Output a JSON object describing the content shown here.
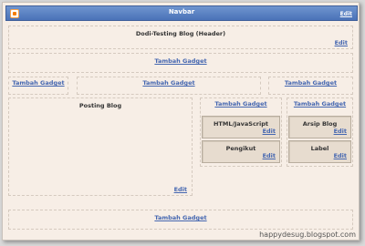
{
  "navbar": {
    "title": "Navbar",
    "edit_label": "Edit"
  },
  "header": {
    "title": "Dodi-Testing Blog (Header)",
    "edit_label": "Edit"
  },
  "gadget_link": "Tambah Gadget",
  "main": {
    "title": "Posting Blog",
    "edit_label": "Edit"
  },
  "widgets": [
    {
      "label": "HTML/JavaScript",
      "edit_label": "Edit"
    },
    {
      "label": "Arsip Blog",
      "edit_label": "Edit"
    },
    {
      "label": "Pengikut",
      "edit_label": "Edit"
    },
    {
      "label": "Label",
      "edit_label": "Edit"
    }
  ],
  "watermark": "happydesug.blogspot.com",
  "colors": {
    "navbar": "#4a72b8",
    "link": "#4466b0",
    "canvas": "#f7eee6",
    "widget": "#e7dccf"
  }
}
